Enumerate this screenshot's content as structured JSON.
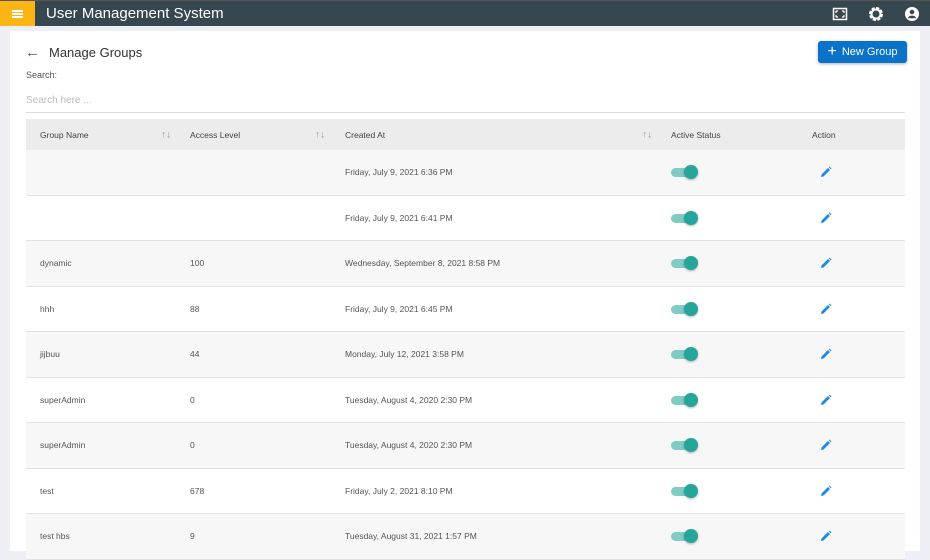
{
  "app": {
    "title": "User Management System"
  },
  "page": {
    "title": "Manage Groups",
    "new_button": "New Group",
    "search_label": "Search:",
    "search_placeholder": "Search here ...",
    "search_value": ""
  },
  "table": {
    "headers": {
      "group_name": "Group Name",
      "access_level": "Access Level",
      "created_at": "Created At",
      "active_status": "Active Status",
      "action": "Action"
    },
    "rows": [
      {
        "name": "",
        "level": "",
        "created": "Friday, July 9, 2021 6:36 PM",
        "active": true
      },
      {
        "name": "",
        "level": "",
        "created": "Friday, July 9, 2021 6:41 PM",
        "active": true
      },
      {
        "name": "dynamic",
        "level": "100",
        "created": "Wednesday, September 8, 2021 8:58 PM",
        "active": true
      },
      {
        "name": "hhh",
        "level": "88",
        "created": "Friday, July 9, 2021 6:45 PM",
        "active": true
      },
      {
        "name": "jijbuu",
        "level": "44",
        "created": "Monday, July 12, 2021 3:58 PM",
        "active": true
      },
      {
        "name": "superAdmin",
        "level": "0",
        "created": "Tuesday, August 4, 2020 2:30 PM",
        "active": true
      },
      {
        "name": "superAdmin",
        "level": "0",
        "created": "Tuesday, August 4, 2020 2:30 PM",
        "active": true
      },
      {
        "name": "test",
        "level": "678",
        "created": "Friday, July 2, 2021 8:10 PM",
        "active": true
      },
      {
        "name": "test hbs",
        "level": "9",
        "created": "Tuesday, August 31, 2021 1:57 PM",
        "active": true
      }
    ]
  },
  "colors": {
    "topbar": "#37474f",
    "menu": "#fdb515",
    "primary": "#0a72c9",
    "toggle": "#26a69a",
    "edit": "#1e88e5"
  }
}
